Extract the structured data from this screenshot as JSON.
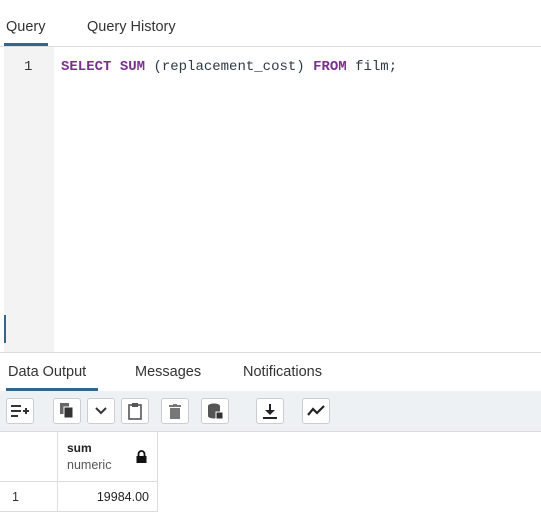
{
  "editor_tabs": [
    "Query",
    "Query History"
  ],
  "editor": {
    "line_number": "1",
    "tokens": [
      "SELECT",
      " ",
      "SUM",
      " (replacement_cost) ",
      "FROM",
      " film;"
    ]
  },
  "output_tabs": [
    "Data Output",
    "Messages",
    "Notifications"
  ],
  "toolbar_icons": [
    "add-row-icon",
    "copy-icon",
    "chevron-down-icon",
    "paste-icon",
    "delete-icon",
    "save-data-icon",
    "download-icon",
    "graph-icon"
  ],
  "results": {
    "columns": [
      {
        "name": "sum",
        "type": "numeric",
        "locked": true
      }
    ],
    "rows": [
      {
        "index": "1",
        "values": [
          "19984.00"
        ]
      }
    ]
  },
  "colors": {
    "accent": "#326690",
    "keyword": "#7b2f8e"
  }
}
